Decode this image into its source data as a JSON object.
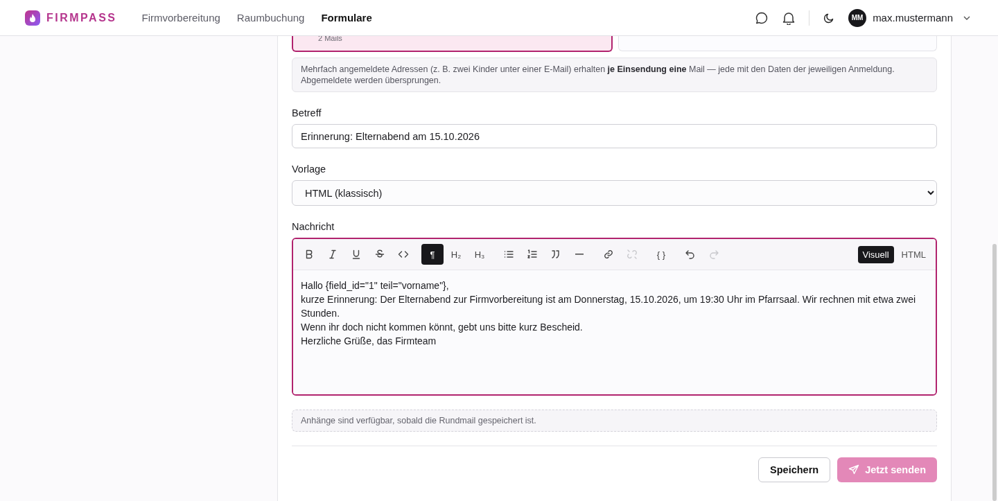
{
  "header": {
    "brand": "FIRMPASS",
    "nav": [
      {
        "label": "Firmvorbereitung",
        "selected": false
      },
      {
        "label": "Raumbuchung",
        "selected": false
      },
      {
        "label": "Formulare",
        "selected": true
      }
    ],
    "user": {
      "initials": "MM",
      "name": "max.mustermann"
    }
  },
  "recipient_cards": [
    {
      "caption": "2 Mails",
      "selected": true
    },
    {
      "selected": false
    }
  ],
  "notice": "Mehrfach angemeldete Adressen (z. B. zwei Kinder unter einer E-Mail) erhalten **je Einsendung eine** Mail — jede mit den Daten der jeweiligen Anmeldung. Abgemeldete werden übersprungen.",
  "subject": {
    "label": "Betreff",
    "value": "Erinnerung: Elternabend am 15.10.2026"
  },
  "template": {
    "label": "Vorlage",
    "value": "HTML (klassisch)"
  },
  "message": {
    "label": "Nachricht",
    "toolbar": [
      [
        {
          "kind": "bold",
          "selected": false,
          "disabled": false
        },
        {
          "kind": "italic",
          "selected": false,
          "disabled": false
        },
        {
          "kind": "underline",
          "selected": false,
          "disabled": false
        },
        {
          "kind": "strike",
          "selected": false,
          "disabled": false
        },
        {
          "kind": "code",
          "selected": false,
          "disabled": false
        }
      ],
      [
        {
          "kind": "text",
          "label": "¶",
          "selected": true,
          "disabled": false
        },
        {
          "kind": "text",
          "label": "H₂",
          "selected": false,
          "disabled": false
        },
        {
          "kind": "text",
          "label": "H₃",
          "selected": false,
          "disabled": false
        }
      ],
      [
        {
          "kind": "bullets",
          "selected": false,
          "disabled": false
        },
        {
          "kind": "numbers",
          "selected": false,
          "disabled": false
        },
        {
          "kind": "quote",
          "selected": false,
          "disabled": false
        },
        {
          "kind": "rule",
          "selected": false,
          "disabled": false
        }
      ],
      [
        {
          "kind": "link",
          "selected": false,
          "disabled": false
        },
        {
          "kind": "unlink",
          "selected": false,
          "disabled": true
        }
      ],
      [
        {
          "kind": "text",
          "label": "{ }",
          "selected": false,
          "disabled": false
        }
      ],
      [
        {
          "kind": "undo",
          "selected": false,
          "disabled": false
        },
        {
          "kind": "redo",
          "selected": false,
          "disabled": true
        }
      ]
    ],
    "modes": [
      {
        "label": "Visuell",
        "selected": true
      },
      {
        "label": "HTML",
        "selected": false
      }
    ],
    "lines": [
      "Hallo {field_id=\"1\" teil=\"vorname\"},",
      "kurze Erinnerung: Der Elternabend zur Firmvorbereitung ist am Donnerstag, 15.10.2026, um 19:30 Uhr im Pfarrsaal. Wir rechnen mit etwa zwei Stunden.",
      "Wenn ihr doch nicht kommen könnt, gebt uns bitte kurz Bescheid.",
      "Herzliche Grüße, das Firmteam"
    ]
  },
  "attachments_note": "Anhänge sind verfügbar, sobald die Rundmail gespeichert ist.",
  "actions": [
    {
      "label": "Speichern",
      "kind": "secondary",
      "disabled": false
    },
    {
      "label": "Jetzt senden",
      "kind": "primary",
      "disabled": true
    }
  ]
}
